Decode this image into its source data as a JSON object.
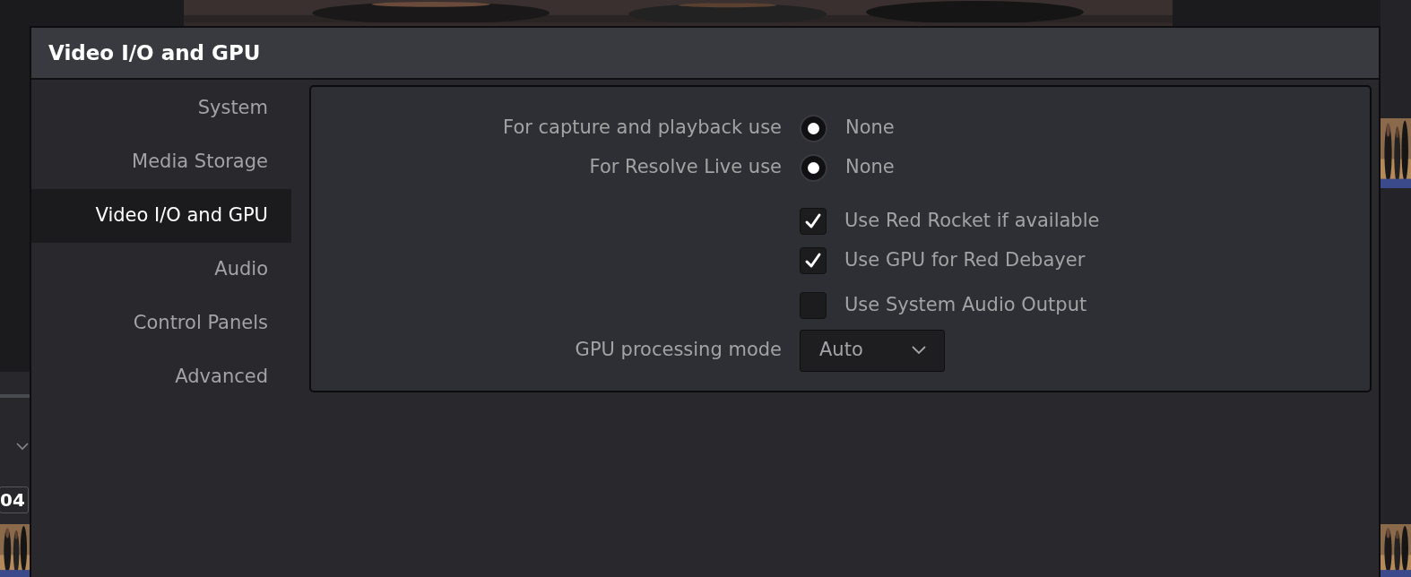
{
  "background": {
    "timecode": "04"
  },
  "dialog": {
    "title": "Video I/O and GPU",
    "sidebar": {
      "items": [
        {
          "label": "System",
          "selected": false
        },
        {
          "label": "Media Storage",
          "selected": false
        },
        {
          "label": "Video I/O and GPU",
          "selected": true
        },
        {
          "label": "Audio",
          "selected": false
        },
        {
          "label": "Control Panels",
          "selected": false
        },
        {
          "label": "Advanced",
          "selected": false
        }
      ]
    },
    "settings": [
      {
        "kind": "radio",
        "label": "For capture and playback use",
        "option": "None",
        "selected": true
      },
      {
        "kind": "radio",
        "label": "For Resolve Live use",
        "option": "None",
        "selected": true
      },
      {
        "kind": "checkbox",
        "option": "Use Red Rocket if available",
        "checked": true
      },
      {
        "kind": "checkbox",
        "option": "Use GPU for Red Debayer",
        "checked": true
      },
      {
        "kind": "checkbox",
        "option": "Use System Audio Output",
        "checked": false
      },
      {
        "kind": "dropdown",
        "label": "GPU processing mode",
        "value": "Auto"
      }
    ]
  }
}
